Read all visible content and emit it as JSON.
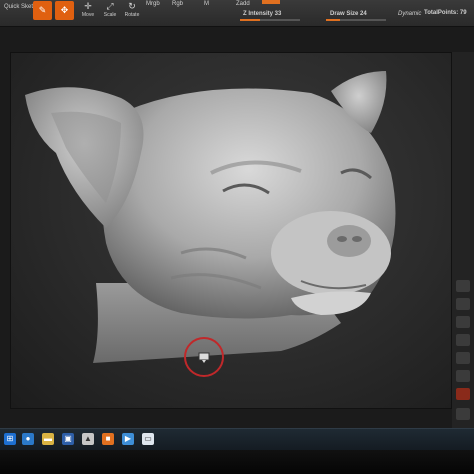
{
  "toolbar": {
    "quick_sketch": "Quick Sketch",
    "move_label": "Move",
    "scale_label": "Scale",
    "rotate_label": "Rotate",
    "mrgb_label": "Mrgb",
    "rgb_label": "Rgb",
    "m_label": "M",
    "zadd_label": "Zadd",
    "intensity_text": "Z Intensity 33",
    "draw_size_text": "Draw Size 24",
    "dynamic_label": "Dynamic",
    "total_points_text": "TotalPoints: 79",
    "intensity_value": 33,
    "draw_size_value": 24
  },
  "sidebar_right": {
    "items": [
      "",
      "",
      "",
      "",
      "",
      "",
      "",
      ""
    ]
  },
  "colors": {
    "accent": "#e06010",
    "toolbar_bg": "#2f2f2f",
    "canvas_bg": "#2e2e2e",
    "sculpt_clay": "#bdbdbd",
    "cursor_ring": "#c0282a",
    "taskbar_bg": "#18212a"
  },
  "icons": {
    "edit_icon": "edit-icon",
    "draw_icon": "draw-icon",
    "move_icon": "move-icon",
    "scale_icon": "scale-icon",
    "rotate_icon": "rotate-icon",
    "cursor_icon": "brush-cursor-icon"
  }
}
